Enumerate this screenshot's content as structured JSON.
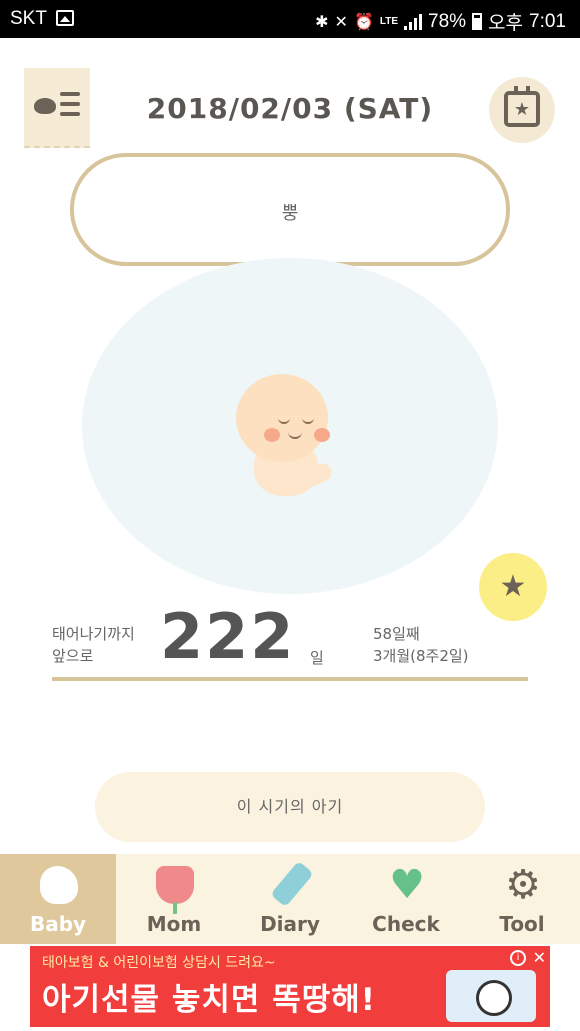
{
  "status_bar": {
    "carrier": "SKT",
    "battery": "78%",
    "ampm": "오후",
    "time": "7:01",
    "lte": "LTE"
  },
  "header": {
    "date": "2018/02/03 (SAT)"
  },
  "bubble": {
    "text": "뿡"
  },
  "countdown": {
    "prefix": "태어나기까지\n앞으로",
    "days": "222",
    "unit": "일",
    "day_count": "58일째",
    "month_week": "3개월(8주2일)"
  },
  "period_button": {
    "label": "이 시기의 아기"
  },
  "bottom_nav": {
    "items": [
      {
        "label": "Baby",
        "icon": "bird-icon",
        "active": true
      },
      {
        "label": "Mom",
        "icon": "tulip-icon",
        "active": false
      },
      {
        "label": "Diary",
        "icon": "pencil-icon",
        "active": false
      },
      {
        "label": "Check",
        "icon": "heartbeat-icon",
        "active": false
      },
      {
        "label": "Tool",
        "icon": "gear-icon",
        "active": false
      }
    ]
  },
  "ad": {
    "line1": "태아보험 & 어린이보험 상담시 드려요~",
    "line2": "아기선물 놓치면 똑땅해!"
  },
  "colors": {
    "accent": "#d8c49a",
    "nav_active": "#dfc99c",
    "favorite": "#fbee86",
    "ad": "#f23d3d"
  }
}
